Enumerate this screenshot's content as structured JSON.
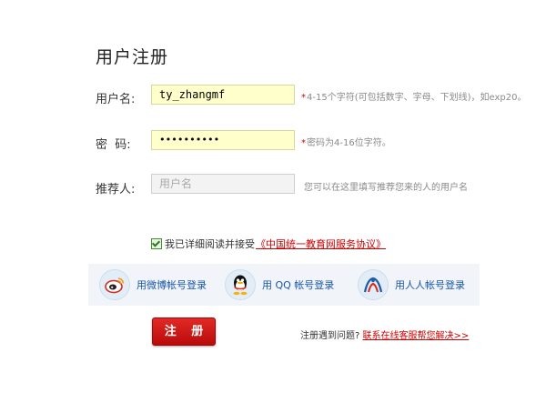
{
  "page": {
    "title": "用户注册"
  },
  "form": {
    "username": {
      "label": "用户名:",
      "value": "ty_zhangmf",
      "hint_marker": "*",
      "hint": "4-15个字符(可包括数字、字母、下划线)，如exp20。"
    },
    "password": {
      "label": "密  码:",
      "value": "••••••••••",
      "hint_marker": "*",
      "hint": "密码为4-16位字符。"
    },
    "referrer": {
      "label": "推荐人:",
      "placeholder": "用户名",
      "hint": "您可以在这里填写推荐您来的人的用户名"
    }
  },
  "agreement": {
    "checked": true,
    "text": "我已详细阅读并接受",
    "link": "《中国统一教育网服务协议》"
  },
  "social_login": [
    {
      "icon": "weibo-icon",
      "label": "用微博帐号登录"
    },
    {
      "icon": "qq-icon",
      "label": "用 QQ 帐号登录"
    },
    {
      "icon": "renren-icon",
      "label": "用人人帐号登录"
    }
  ],
  "register_button": "注 册",
  "help": {
    "text": "注册遇到问题?",
    "link": "联系在线客服帮您解决>>"
  },
  "colors": {
    "accent_red": "#cc0000",
    "input_fill": "#ffffcc",
    "link_blue": "#1a56a6"
  }
}
